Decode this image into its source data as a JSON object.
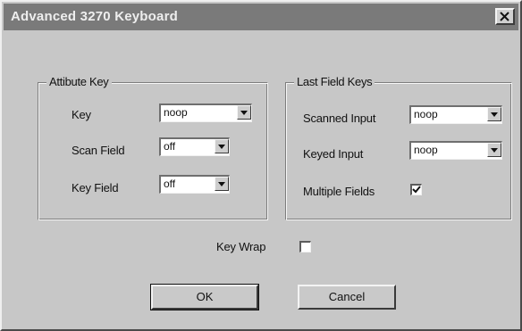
{
  "window": {
    "title": "Advanced 3270 Keyboard",
    "close_glyph": "x"
  },
  "attribute_key": {
    "title": "Attibute Key",
    "key_label": "Key",
    "key_value": "noop",
    "scan_field_label": "Scan Field",
    "scan_field_value": "off",
    "key_field_label": "Key Field",
    "key_field_value": "off"
  },
  "last_field_keys": {
    "title": "Last Field Keys",
    "scanned_input_label": "Scanned Input",
    "scanned_input_value": "noop",
    "keyed_input_label": "Keyed Input",
    "keyed_input_value": "noop",
    "multiple_fields_label": "Multiple Fields",
    "multiple_fields_checked": true
  },
  "key_wrap": {
    "label": "Key Wrap",
    "checked": false
  },
  "buttons": {
    "ok": "OK",
    "cancel": "Cancel"
  }
}
